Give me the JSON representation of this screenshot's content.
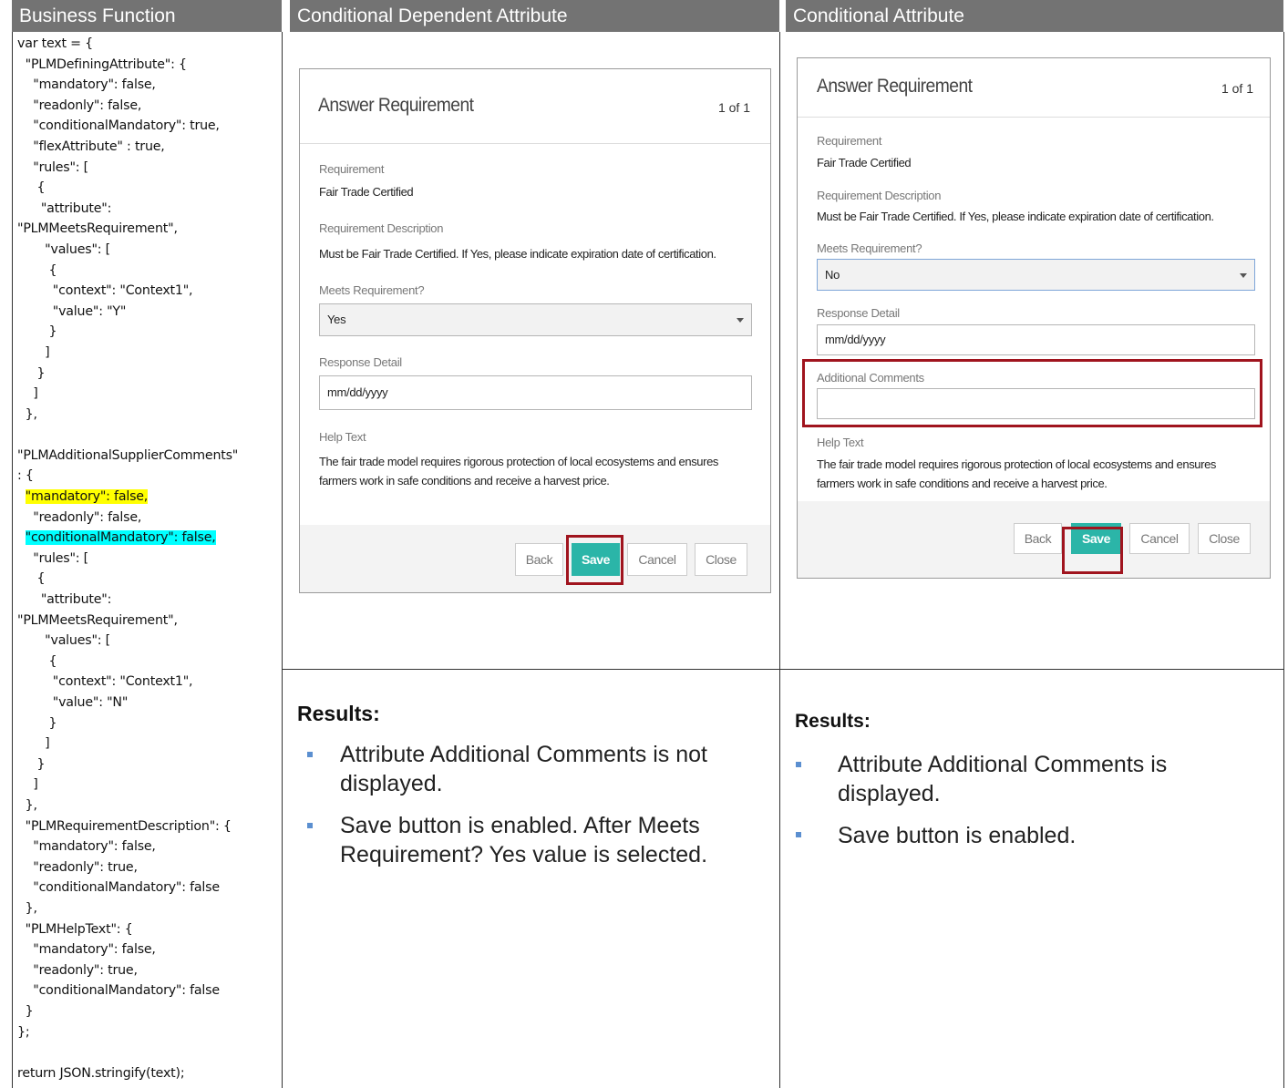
{
  "headers": {
    "col1": "Business Function",
    "col2": "Conditional Dependent  Attribute",
    "col3": "Conditional Attribute"
  },
  "code_lines": [
    "var text = {",
    "  \"PLMDefiningAttribute\": {",
    "    \"mandatory\": false,",
    "    \"readonly\": false,",
    "    \"conditionalMandatory\": true,",
    "    \"flexAttribute\" : true,",
    "    \"rules\": [",
    "     {",
    "      \"attribute\":",
    "\"PLMMeetsRequirement\",",
    "       \"values\": [",
    "        {",
    "         \"context\": \"Context1\",",
    "         \"value\": \"Y\"",
    "        }",
    "       ]",
    "     }",
    "    ]",
    "  },",
    "",
    "\"PLMAdditionalSupplierComments\"",
    ": {",
    "  ",
    "    \"readonly\": false,",
    "  ",
    "    \"rules\": [",
    "     {",
    "      \"attribute\":",
    "\"PLMMeetsRequirement\",",
    "       \"values\": [",
    "        {",
    "         \"context\": \"Context1\",",
    "         \"value\": \"N\"",
    "        }",
    "       ]",
    "     }",
    "    ]",
    "  },",
    "  \"PLMRequirementDescription\": {",
    "    \"mandatory\": false,",
    "    \"readonly\": true,",
    "    \"conditionalMandatory\": false",
    "  },",
    "  \"PLMHelpText\": {",
    "    \"mandatory\": false,",
    "    \"readonly\": true,",
    "    \"conditionalMandatory\": false",
    "  }",
    "};",
    "",
    "return JSON.stringify(text);"
  ],
  "code_highlights": {
    "yellow": "\"mandatory\": false,",
    "cyan": "\"conditionalMandatory\": false,"
  },
  "dialog1": {
    "title": "Answer Requirement",
    "count": "1 of 1",
    "requirement_label": "Requirement",
    "requirement_value": "Fair Trade Certified",
    "description_label": "Requirement Description",
    "description_value": "Must be Fair Trade Certified. If Yes, please indicate expiration date of certification.",
    "meets_label": "Meets Requirement?",
    "meets_value": "Yes",
    "response_label": "Response Detail",
    "response_placeholder": "mm/dd/yyyy",
    "help_label": "Help Text",
    "help_line1": "The fair trade model requires rigorous protection of local ecosystems and ensures",
    "help_line2": "farmers work in safe conditions and receive a harvest price.",
    "buttons": {
      "back": "Back",
      "save": "Save",
      "cancel": "Cancel",
      "close": "Close"
    }
  },
  "dialog2": {
    "title": "Answer Requirement",
    "count": "1 of 1",
    "requirement_label": "Requirement",
    "requirement_value": "Fair Trade Certified",
    "description_label": "Requirement Description",
    "description_value": "Must be Fair Trade Certified. If Yes, please indicate expiration date of certification.",
    "meets_label": "Meets Requirement?",
    "meets_value": "No",
    "response_label": "Response Detail",
    "response_placeholder": "mm/dd/yyyy",
    "comments_label": "Additional Comments",
    "help_label": "Help Text",
    "help_line1": "The fair trade model requires rigorous protection of local ecosystems and ensures",
    "help_line2": "farmers work in safe conditions and receive a harvest price.",
    "buttons": {
      "back": "Back",
      "save": "Save",
      "cancel": "Cancel",
      "close": "Close"
    }
  },
  "results1": {
    "title": "Results:",
    "bullet1_line1": "Attribute Additional Comments is not",
    "bullet1_line2": "displayed.",
    "bullet2_line1": "Save button is enabled. After Meets",
    "bullet2_line2": "Requirement? Yes value is selected."
  },
  "results2": {
    "title": "Results:",
    "bullet1_line1": "Attribute Additional Comments is",
    "bullet1_line2": "displayed.",
    "bullet2_line1": "Save button is enabled."
  },
  "colors": {
    "header_bg": "#737373",
    "save_button": "#2bb5a8",
    "highlight_box": "#a0141e",
    "yellow_highlight": "#ffff00",
    "cyan_highlight": "#00ffff",
    "bullet": "#5b8fd0"
  }
}
